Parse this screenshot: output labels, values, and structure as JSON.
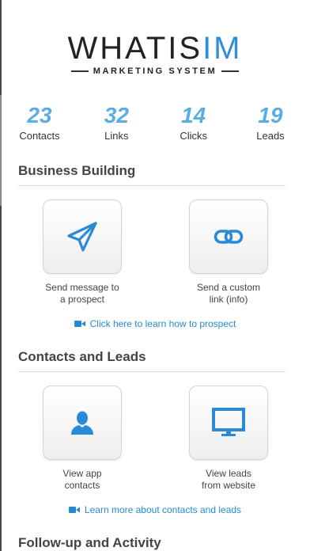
{
  "logo": {
    "main": "WHATIS",
    "accent": "IM",
    "subtitle": "MARKETING SYSTEM"
  },
  "stats": [
    {
      "value": "23",
      "label": "Contacts"
    },
    {
      "value": "32",
      "label": "Links"
    },
    {
      "value": "14",
      "label": "Clicks"
    },
    {
      "value": "19",
      "label": "Leads"
    }
  ],
  "sections": {
    "business": {
      "title": "Business Building",
      "tile_left": "Send message to\na prospect",
      "tile_right": "Send a custom\nlink (info)",
      "learn": "Click here to learn how to prospect"
    },
    "contacts": {
      "title": "Contacts and Leads",
      "tile_left": "View app\ncontacts",
      "tile_right": "View leads\nfrom website",
      "learn": "Learn more about contacts and leads"
    },
    "followup": {
      "title": "Follow-up and Activity"
    }
  },
  "colors": {
    "accent": "#2f8fd6",
    "stat": "#5aaee3",
    "icon": "#2a8ad6",
    "link": "#2789d0"
  },
  "icons": [
    "send-icon",
    "link-icon",
    "person-icon",
    "monitor-icon",
    "video-camera-icon"
  ]
}
